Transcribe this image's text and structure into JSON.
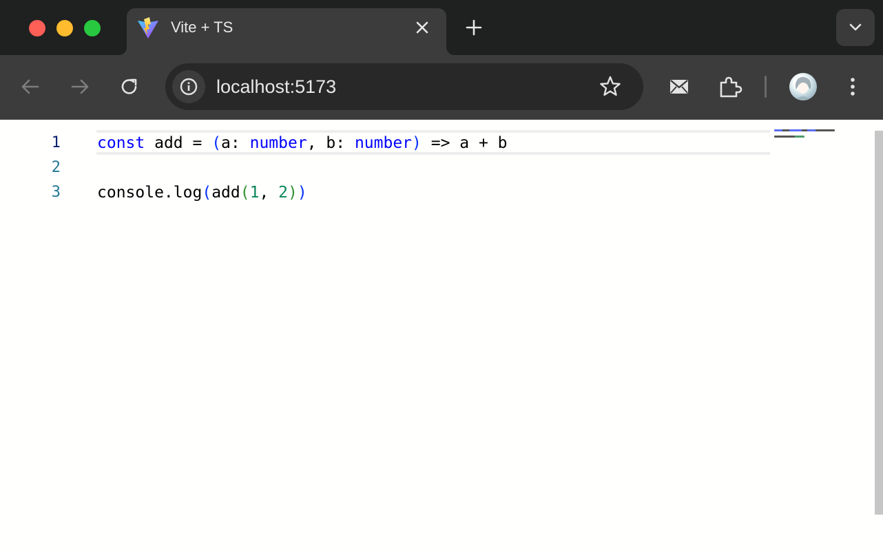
{
  "window": {
    "controls": [
      "close",
      "minimize",
      "zoom"
    ]
  },
  "tab": {
    "title": "Vite + TS",
    "favicon": "vite-logo-icon",
    "close_icon": "close-icon"
  },
  "new_tab_icon": "plus-icon",
  "tab_search_icon": "chevron-down-icon",
  "toolbar": {
    "back_icon": "arrow-left-icon",
    "forward_icon": "arrow-right-icon",
    "reload_icon": "reload-icon",
    "site_info_icon": "info-icon",
    "url": "localhost:5173",
    "bookmark_icon": "star-icon",
    "extensions": [
      "mail-extension-icon",
      "puzzle-icon"
    ],
    "menu_icon": "kebab-menu-icon"
  },
  "editor": {
    "language": "typescript",
    "active_line": 1,
    "lines": [
      {
        "number": "1",
        "text": "const add = (a: number, b: number) => a + b"
      },
      {
        "number": "2",
        "text": ""
      },
      {
        "number": "3",
        "text": "console.log(add(1, 2))"
      }
    ],
    "tokens_line1": [
      "const",
      " add = ",
      "(",
      "a: ",
      "number",
      ", b: ",
      "number",
      ")",
      " => a + b"
    ],
    "tokens_line3": [
      "console.log",
      "(",
      "add",
      "(",
      "1",
      ", ",
      "2",
      ")",
      ")"
    ]
  },
  "colors": {
    "keyword": "#0000ff",
    "number": "#098658",
    "bracket_level1": "#0431fa",
    "bracket_level2": "#319331",
    "line_number": "#237893",
    "line_number_active": "#0b216f"
  }
}
